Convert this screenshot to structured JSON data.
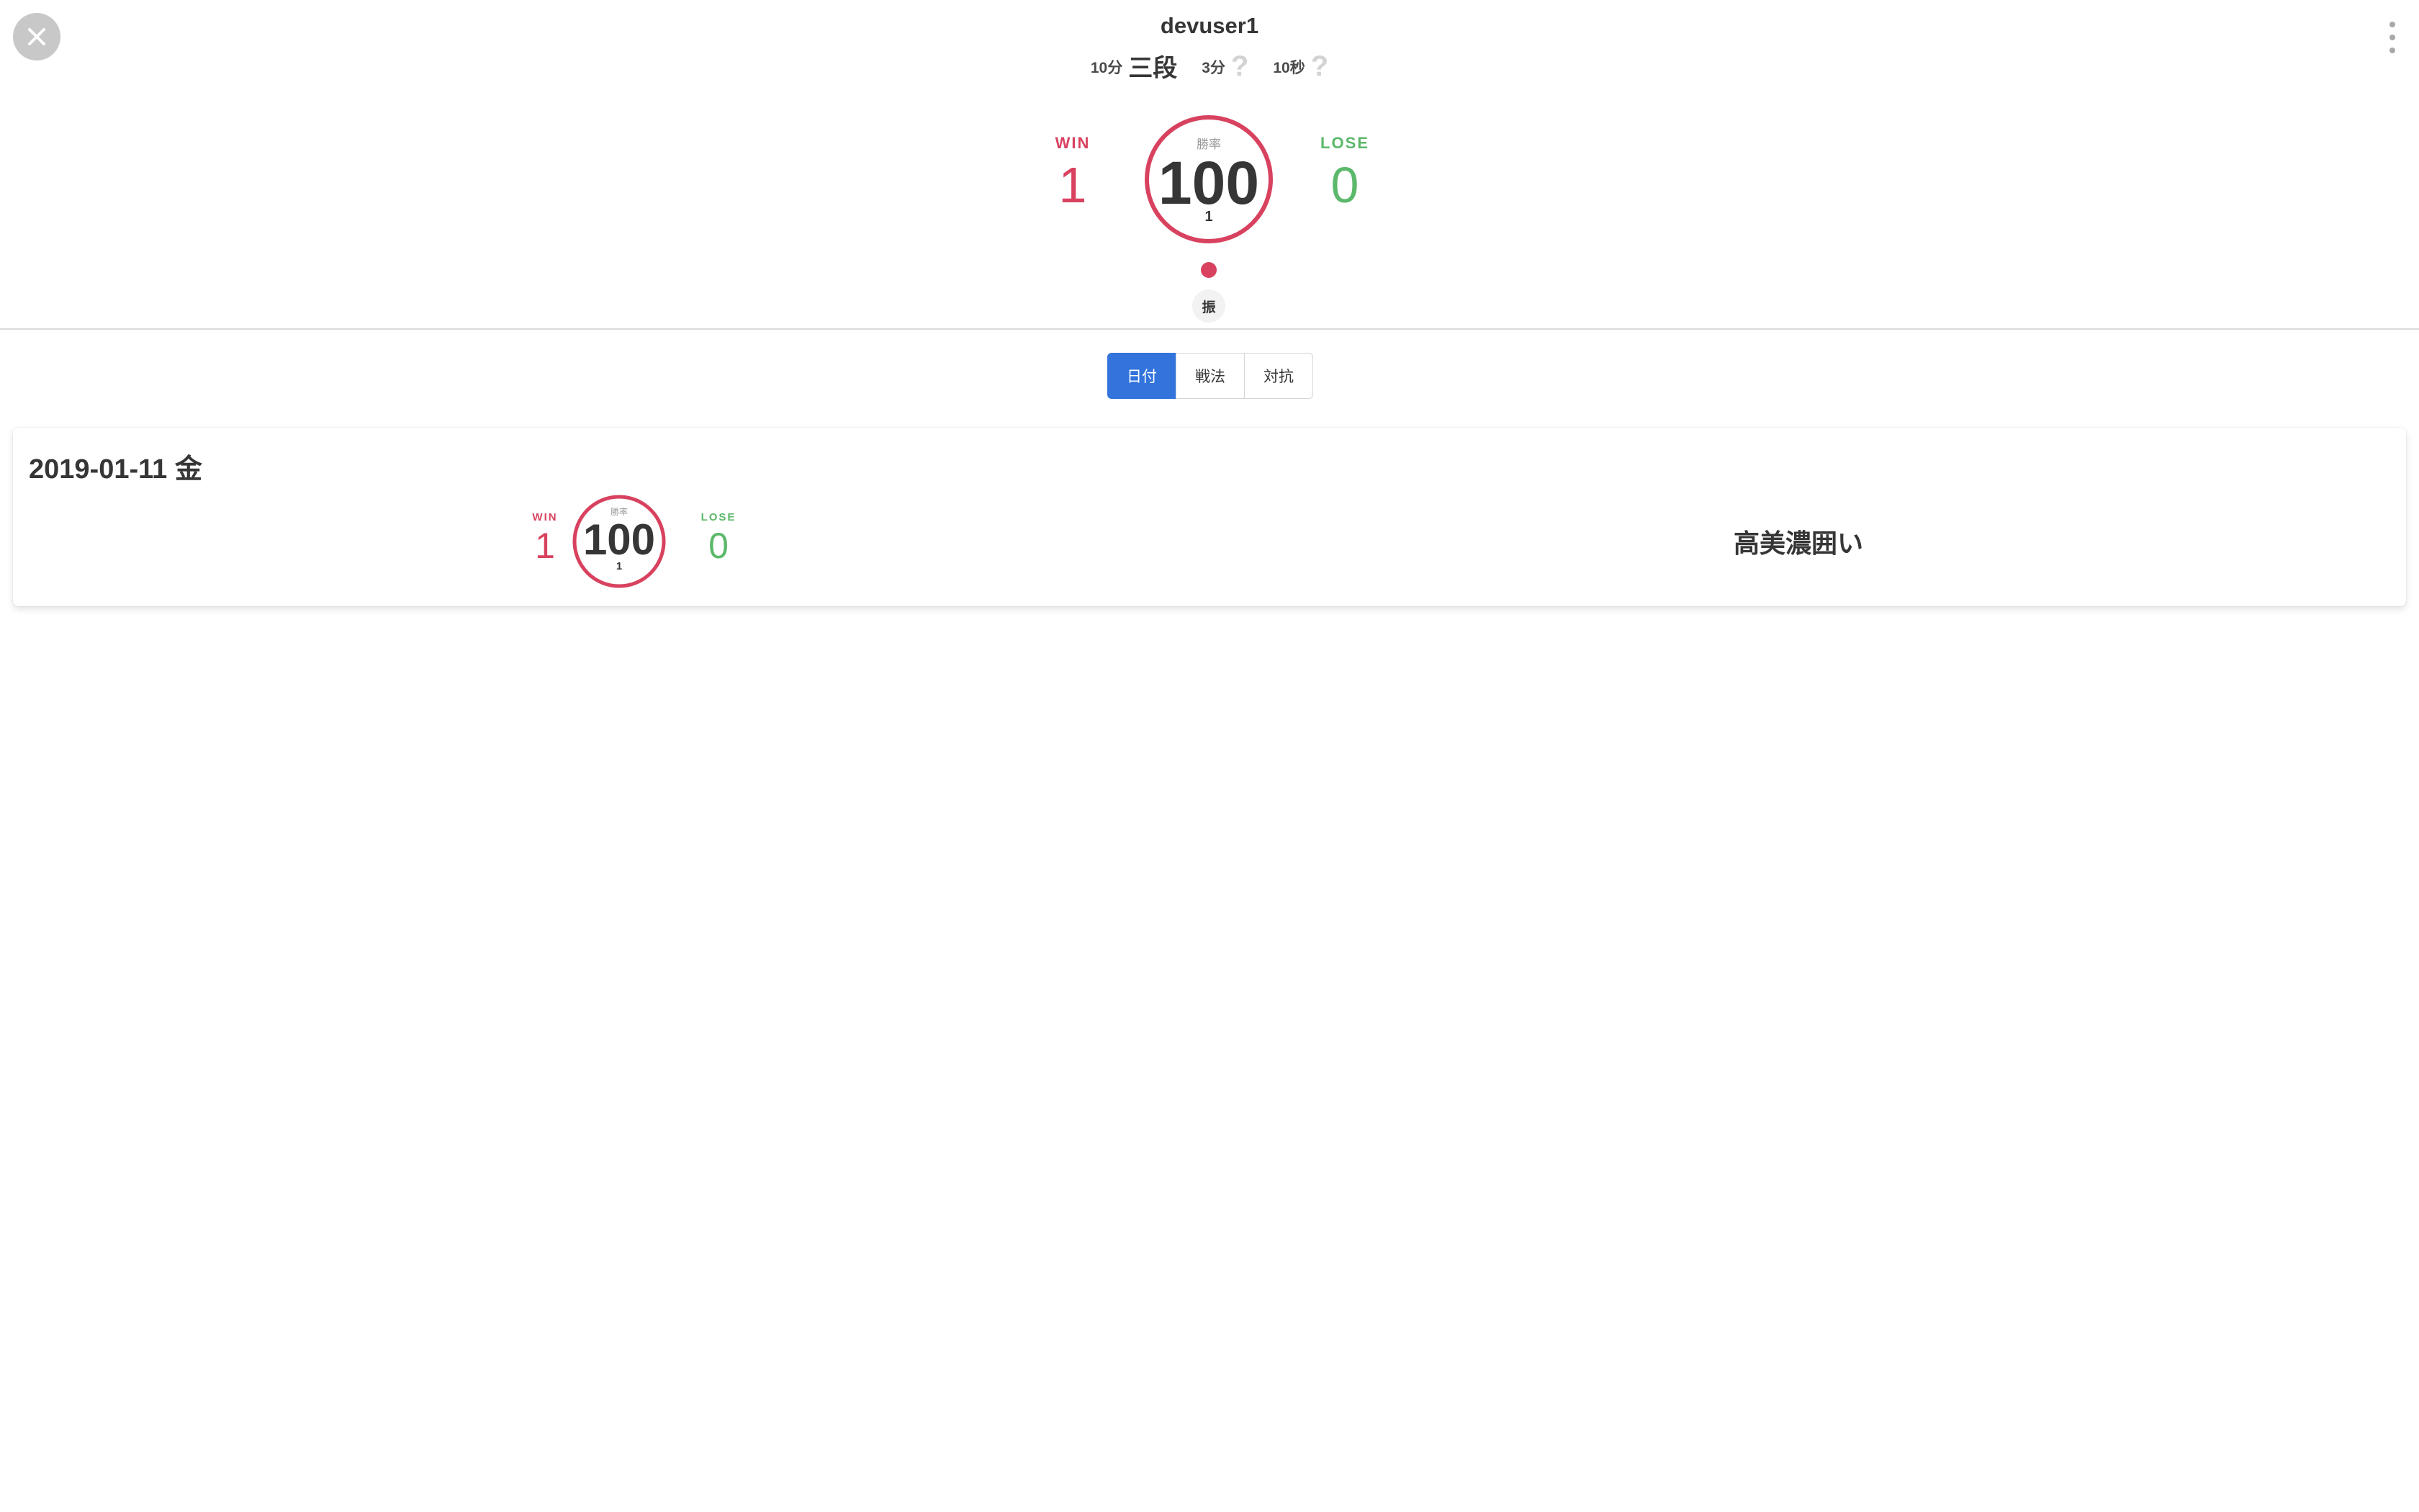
{
  "header": {
    "username": "devuser1",
    "ranks": [
      {
        "rule": "10分",
        "grade": "三段",
        "known": true
      },
      {
        "rule": "3分",
        "grade": "?",
        "known": false
      },
      {
        "rule": "10秒",
        "grade": "?",
        "known": false
      }
    ]
  },
  "summary": {
    "win_label": "WIN",
    "win_count": "1",
    "lose_label": "LOSE",
    "lose_count": "0",
    "rate_label": "勝率",
    "rate_value": "100",
    "rate_fraction": 1.0,
    "total_games": "1",
    "style_tag": "振"
  },
  "tabs": [
    {
      "label": "日付",
      "active": true
    },
    {
      "label": "戦法",
      "active": false
    },
    {
      "label": "対抗",
      "active": false
    }
  ],
  "records": [
    {
      "date": "2019-01-11 金",
      "win_label": "WIN",
      "win_count": "1",
      "lose_label": "LOSE",
      "lose_count": "0",
      "rate_label": "勝率",
      "rate_value": "100",
      "rate_fraction": 1.0,
      "total_games": "1",
      "tactic": "高美濃囲い"
    }
  ],
  "colors": {
    "win": "#d8425f",
    "lose": "#5cb86a",
    "active_tab": "#3273dc"
  }
}
